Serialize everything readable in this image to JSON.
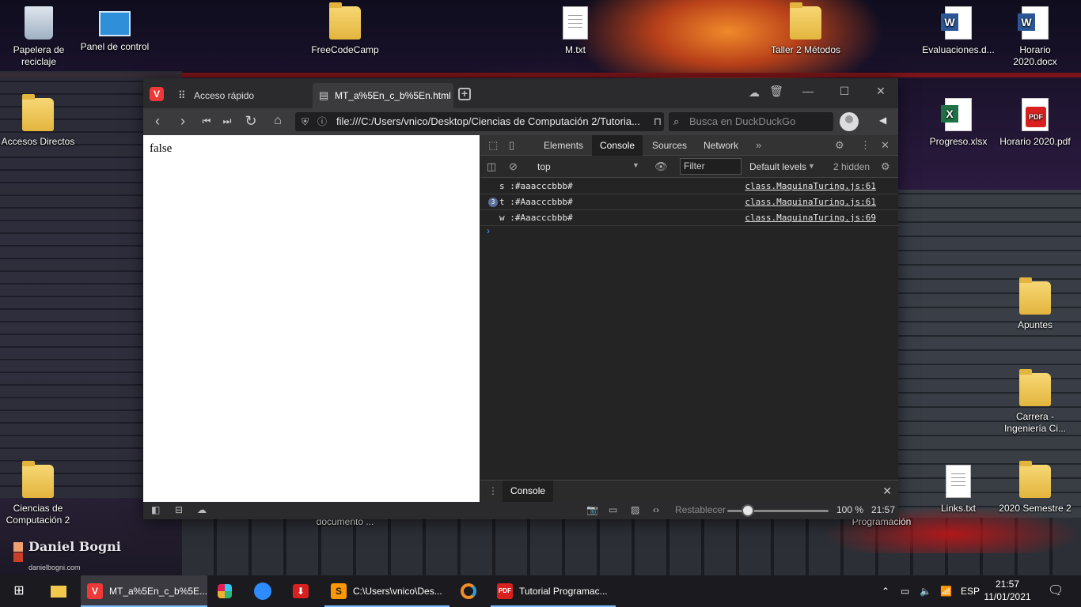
{
  "desktop": {
    "icons": [
      {
        "label": "Papelera de reciclaje",
        "kind": "bin"
      },
      {
        "label": "Panel de control",
        "kind": "panel"
      },
      {
        "label": "FreeCodeCamp",
        "kind": "folder"
      },
      {
        "label": "M.txt",
        "kind": "file"
      },
      {
        "label": "Taller 2 Métodos",
        "kind": "folder"
      },
      {
        "label": "Evaluaciones.d...",
        "kind": "word"
      },
      {
        "label": "Horario 2020.docx",
        "kind": "word"
      },
      {
        "label": "Accesos Directos",
        "kind": "folder"
      },
      {
        "label": "Progreso.xlsx",
        "kind": "excel"
      },
      {
        "label": "Horario 2020.pdf",
        "kind": "pdf"
      },
      {
        "label": "Apuntes",
        "kind": "folder"
      },
      {
        "label": "Carrera - Ingeniería Ci...",
        "kind": "folder"
      },
      {
        "label": "Ciencias de Computación 2",
        "kind": "folder"
      },
      {
        "label": "Links.txt",
        "kind": "file"
      },
      {
        "label": "2020 Semestre 2",
        "kind": "folder"
      },
      {
        "label": "documento ...",
        "kind": "hidden"
      },
      {
        "label": "Programación",
        "kind": "hidden"
      }
    ],
    "logo_text": "Daniel Bogni",
    "logo_sub": "danielbogni.com"
  },
  "browser": {
    "logo": "V",
    "tabs": [
      {
        "label": "Acceso rápido",
        "icon": "grid-icon",
        "active": false
      },
      {
        "label": "MT_a%5En_c_b%5En.html",
        "icon": "document-icon",
        "active": true
      }
    ],
    "url": "file:///C:/Users/vnico/Desktop/Ciencias de Computación 2/Tutoria...",
    "search_placeholder": "Busca en DuckDuckGo",
    "page_output": "false"
  },
  "devtools": {
    "tabs": [
      "Elements",
      "Console",
      "Sources",
      "Network"
    ],
    "active_tab": "Console",
    "context": "top",
    "filter_placeholder": "Filter",
    "levels": "Default levels",
    "hidden": "2 hidden",
    "logs": [
      {
        "count": "",
        "message": "s :#aaacccbbb#",
        "source": "class.MaquinaTuring.js:61"
      },
      {
        "count": "3",
        "message": "t :#Aaacccbbb#",
        "source": "class.MaquinaTuring.js:61"
      },
      {
        "count": "",
        "message": "w :#Aaacccbbb#",
        "source": "class.MaquinaTuring.js:69"
      }
    ],
    "prompt": "›",
    "drawer_tab": "Console"
  },
  "status": {
    "reset_label": "Restablecer",
    "zoom": "100 %",
    "zoom_fraction": 0.2,
    "time": "21:57"
  },
  "taskbar": {
    "apps": [
      {
        "label": "MT_a%5En_c_b%5E...",
        "icon": "vivaldi-icon",
        "color": "#ef3939"
      },
      {
        "label": "C:\\Users\\vnico\\Des...",
        "icon": "sublime-icon",
        "color": "#ff9800"
      },
      {
        "label": "Tutorial Programac...",
        "icon": "pdf-icon",
        "color": "#d8201f"
      }
    ],
    "language": "ESP",
    "time": "21:57",
    "date": "11/01/2021"
  },
  "colors": {
    "accent": "#ef3939",
    "devtools_bg": "#242424",
    "link_blue": "#4a9eff"
  }
}
